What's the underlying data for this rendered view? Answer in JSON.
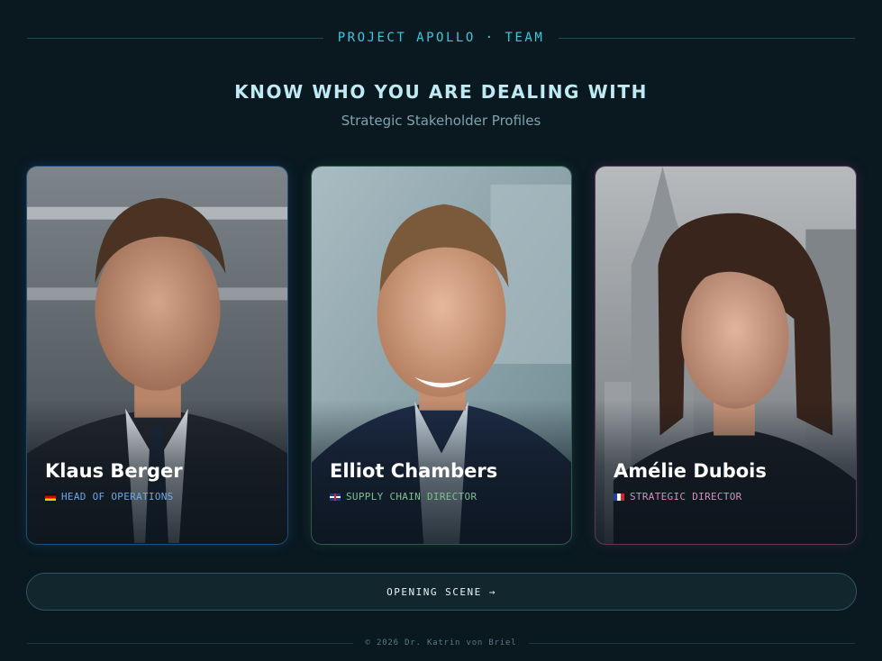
{
  "header": {
    "label": "PROJECT APOLLO · TEAM",
    "title": "KNOW WHO YOU ARE DEALING WITH",
    "subtitle": "Strategic Stakeholder Profiles"
  },
  "profiles": [
    {
      "name": "Klaus Berger",
      "role": "HEAD OF OPERATIONS",
      "flag": "germany-flag-icon",
      "accent": "#6fa6e6"
    },
    {
      "name": "Elliot Chambers",
      "role": "SUPPLY CHAIN DIRECTOR",
      "flag": "uk-flag-icon",
      "accent": "#7fc08e"
    },
    {
      "name": "Amélie Dubois",
      "role": "STRATEGIC DIRECTOR",
      "flag": "france-flag-icon",
      "accent": "#d58fba"
    }
  ],
  "cta": {
    "label": "OPENING SCENE",
    "icon": "arrow-right-icon",
    "arrow": "→"
  },
  "footer": {
    "text": "© 2026 Dr. Katrin von Briel"
  },
  "colors": {
    "background": "#0a1820",
    "accent": "#3cc8dd"
  }
}
